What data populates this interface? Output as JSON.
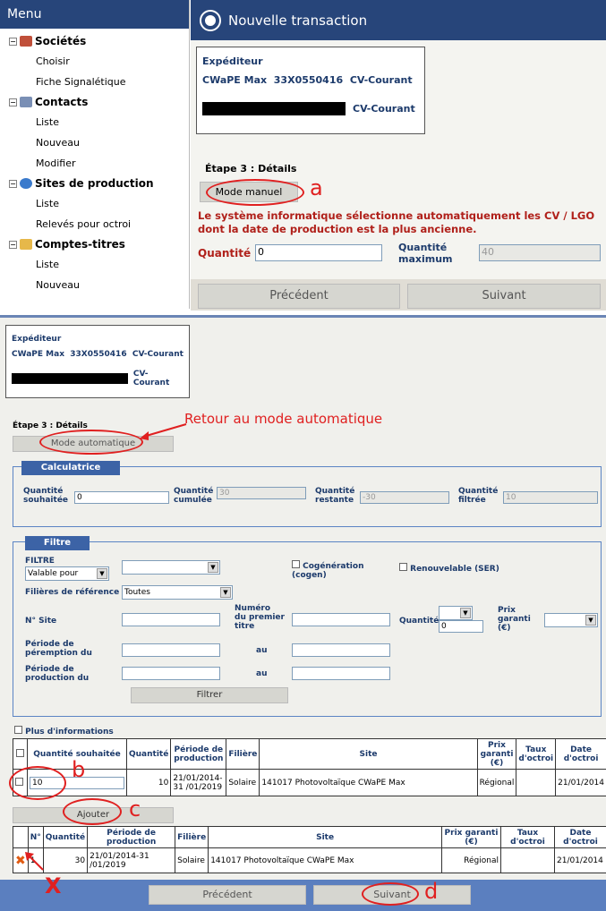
{
  "sidebar": {
    "title": "Menu",
    "sections": [
      {
        "label": "Sociétés",
        "items": [
          "Choisir",
          "Fiche Signalétique"
        ]
      },
      {
        "label": "Contacts",
        "items": [
          "Liste",
          "Nouveau",
          "Modifier"
        ]
      },
      {
        "label": "Sites de production",
        "items": [
          "Liste",
          "Relevés pour octroi"
        ]
      },
      {
        "label": "Comptes-titres",
        "items": [
          "Liste",
          "Nouveau"
        ]
      }
    ]
  },
  "top": {
    "title": "Nouvelle transaction",
    "sender_label": "Expéditeur",
    "sender_name": "CWaPE Max",
    "sender_code": "33X0550416",
    "sender_account": "CV-Courant",
    "receiver_account": "CV-Courant",
    "step": "Étape 3 : Détails",
    "mode_button": "Mode manuel",
    "message": "Le système informatique sélectionne automatiquement les CV / LGO dont la date de production est la plus ancienne.",
    "qty_label": "Quantité",
    "qty_value": "0",
    "max_label": "Quantité maximum",
    "max_value": "40",
    "prev": "Précédent",
    "next": "Suivant"
  },
  "bottom": {
    "sender_label": "Expéditeur",
    "sender_name": "CWaPE Max",
    "sender_code": "33X0550416",
    "sender_account": "CV-Courant",
    "receiver_account": "CV-Courant",
    "step": "Étape 3 : Détails",
    "mode_button": "Mode automatique",
    "annotation_auto": "Retour au mode automatique",
    "calc": {
      "legend": "Calculatrice",
      "souhaitee_label": "Quantité souhaitée",
      "souhaitee": "0",
      "cumulee_label": "Quantité cumulée",
      "cumulee": "30",
      "restante_label": "Quantité restante",
      "restante": "-30",
      "filtree_label": "Quantité filtrée",
      "filtree": "10"
    },
    "filter": {
      "legend": "Filtre",
      "filtre_label": "FILTRE",
      "filtre_value": "Valable pour",
      "cogen": "Cogénération (cogen)",
      "renouv": "Renouvelable (SER)",
      "filieres_label": "Filières de référence",
      "filieres_value": "Toutes",
      "site_label": "N° Site",
      "premier_label": "Numéro du premier titre",
      "qty_label": "Quantité",
      "qty_value": "0",
      "prix_label": "Prix garanti (€)",
      "peremption_label": "Période de péremption du",
      "production_label": "Période de production du",
      "au": "au",
      "button": "Filtrer"
    },
    "plus_info": "Plus d'informations",
    "table1": {
      "headers": [
        "Quantité souhaitée",
        "Quantité",
        "Période de production",
        "Filière",
        "Site",
        "Prix garanti (€)",
        "Taux d'octroi",
        "Date d'octroi"
      ],
      "row": {
        "souhaitee": "10",
        "quantite": "10",
        "periode": "21/01/2014-31 /01/2019",
        "filiere": "Solaire",
        "site": "141017 Photovoltaïque CWaPE Max",
        "prix": "Régional",
        "taux": "",
        "date": "21/01/2014"
      }
    },
    "add_button": "Ajouter",
    "table2": {
      "headers": [
        "N°",
        "Quantité",
        "Période de production",
        "Filière",
        "Site",
        "Prix garanti (€)",
        "Taux d'octroi",
        "Date d'octroi"
      ],
      "row": {
        "n": "1",
        "quantite": "30",
        "periode": "21/01/2014-31 /01/2019",
        "filiere": "Solaire",
        "site": "141017 Photovoltaïque CWaPE Max",
        "prix": "Régional",
        "taux": "",
        "date": "21/01/2014"
      }
    },
    "prev": "Précédent",
    "next": "Suivant"
  },
  "annotations": {
    "a": "a",
    "b": "b",
    "c": "c",
    "d": "d",
    "x": "X"
  },
  "colors": {
    "navy": "#27457a",
    "annotation": "#e02020",
    "label": "#1c3a6b",
    "warning": "#b0201a"
  }
}
